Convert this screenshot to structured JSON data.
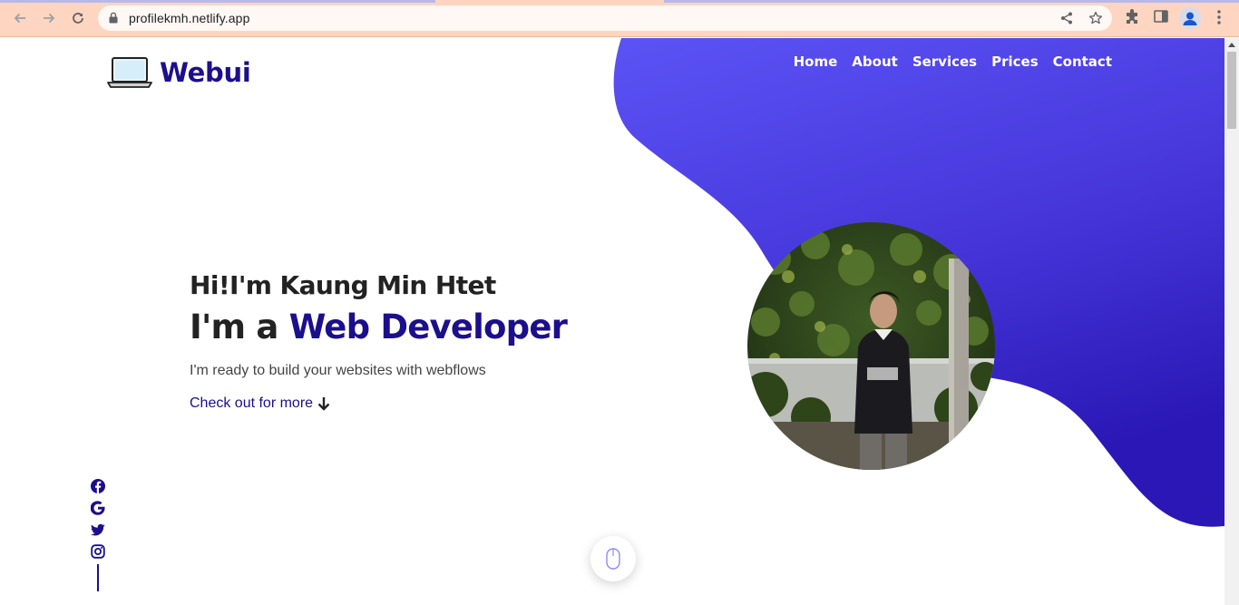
{
  "browser": {
    "url": "profilekmh.netlify.app",
    "icons": [
      "back-arrow-icon",
      "forward-arrow-icon",
      "reload-icon",
      "lock-icon",
      "share-icon",
      "star-icon",
      "extensions-icon",
      "side-panel-icon",
      "profile-icon",
      "menu-dots-icon"
    ]
  },
  "header": {
    "logo_text": "Webui",
    "logo_icon": "laptop-icon",
    "nav": [
      "Home",
      "About",
      "Services",
      "Prices",
      "Contact"
    ]
  },
  "hero": {
    "greeting": "Hi!I'm Kaung Min Htet",
    "role_prefix": "I'm a ",
    "role_highlight": "Web Developer",
    "tagline": "I'm ready to build your websites with webflows",
    "cta": "Check out for more"
  },
  "social": [
    "facebook-icon",
    "google-icon",
    "twitter-icon",
    "instagram-icon"
  ],
  "colors": {
    "accent": "#1c0f8c",
    "blob_top": "#5b53f5",
    "blob_bottom": "#2a17b5",
    "chrome": "#fdd5c0"
  }
}
